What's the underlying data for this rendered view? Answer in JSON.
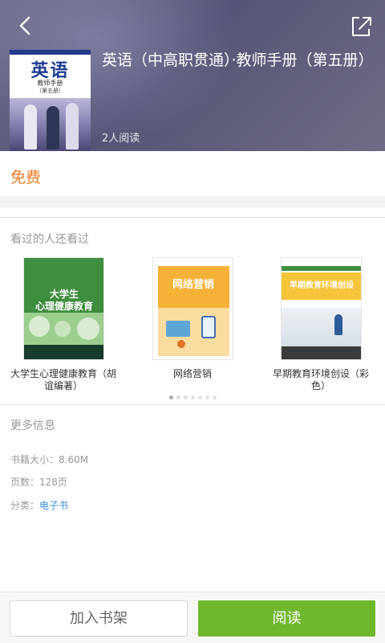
{
  "header": {
    "book_title": "英语（中高职贯通）·教师手册（第五册）",
    "read_count": "2人阅读",
    "cover": {
      "title": "英语",
      "subtitle": "教师手册",
      "edition": "（第五册）"
    }
  },
  "price": {
    "label": "免费",
    "color": "#f47a22"
  },
  "recommend": {
    "title": "看过的人还看过",
    "items": [
      {
        "name": "大学生心理健康教育（胡谊编著）",
        "cover_text": "大学生\n心理健康教育"
      },
      {
        "name": "网络营销",
        "cover_text": "网络营销"
      },
      {
        "name": "早期教育环境创设（彩色）",
        "cover_text": "早期教育环境创设"
      }
    ],
    "page_count": 7,
    "active_page": 0
  },
  "more_info": {
    "title": "更多信息",
    "size": "书籍大小：8.60M",
    "pages": "页数：128页",
    "category_label": "分类：",
    "category_value": "电子书"
  },
  "actions": {
    "add_to_shelf": "加入书架",
    "read": "阅读",
    "read_color": "#6fb82c"
  },
  "icons": {
    "back": "chevron-left-icon",
    "share": "share-icon"
  }
}
